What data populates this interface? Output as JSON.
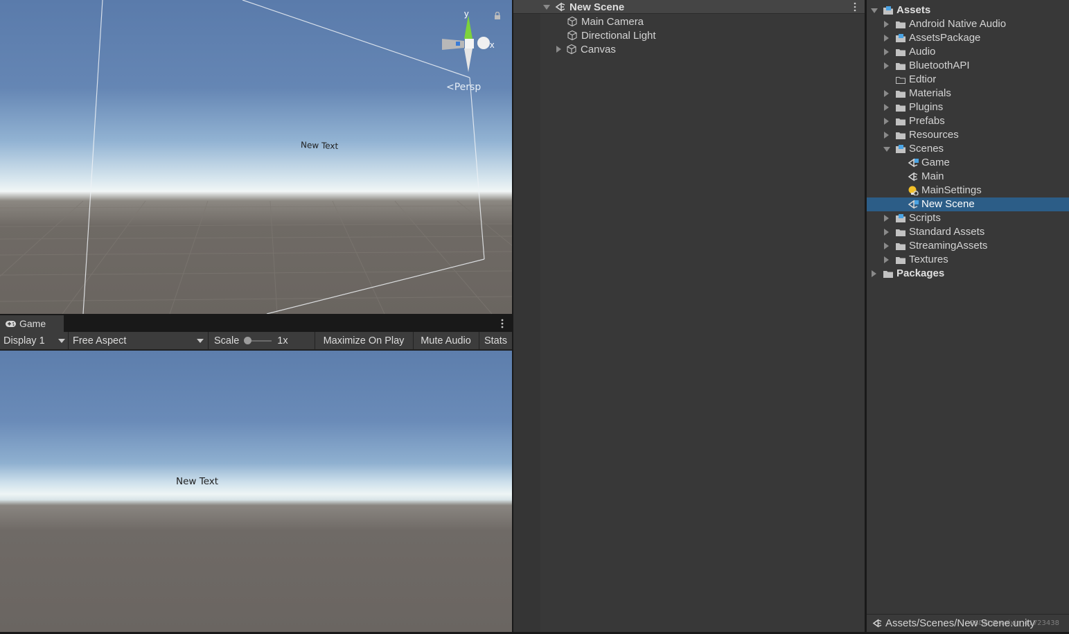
{
  "scene_view": {
    "canvas_text": "New Text",
    "gizmo": {
      "y_axis": "y",
      "x_axis": "x",
      "projection": "Persp"
    }
  },
  "game_view": {
    "tab_label": "Game",
    "display": "Display 1",
    "aspect": "Free Aspect",
    "scale_label": "Scale",
    "scale_value": "1x",
    "maximize_on_play": "Maximize On Play",
    "mute_audio": "Mute Audio",
    "stats": "Stats",
    "canvas_text": "New Text"
  },
  "hierarchy": {
    "scene_name": "New Scene",
    "objects": [
      {
        "label": "Main Camera",
        "expandable": false
      },
      {
        "label": "Directional Light",
        "expandable": false
      },
      {
        "label": "Canvas",
        "expandable": true
      }
    ]
  },
  "project": {
    "assets_root": "Assets",
    "folders_top": [
      "Android Native Audio",
      "AssetsPackage",
      "Audio",
      "BluetoothAPI",
      "Edtior",
      "Materials",
      "Plugins",
      "Prefabs",
      "Resources"
    ],
    "scenes_folder": "Scenes",
    "scenes": [
      "Game",
      "Main",
      "MainSettings",
      "New Scene"
    ],
    "selected_scene": "New Scene",
    "folders_bottom": [
      "Scripts",
      "Standard Assets",
      "StreamingAssets",
      "Textures"
    ],
    "packages_root": "Packages",
    "footer_path": "Assets/Scenes/New Scene.unity",
    "watermark": "CSDN @weixin_41723438"
  },
  "colors": {
    "selection": "#2c5d87",
    "panel_bg": "#383838",
    "toolbar_bg": "#3c3c3c",
    "gizmo_y": "#7dd33b",
    "gizmo_x": "#e8e8e8",
    "scene_icon_blue": "#4aa3e3",
    "settings_icon_yellow": "#f2c029"
  },
  "icons": {
    "game_tab": "gamepad-icon",
    "scene": "unity-scene-icon",
    "gameobject": "cube-icon",
    "folder": "folder-icon",
    "folder_empty": "folder-outline-icon",
    "package_folder": "package-folder-icon",
    "scene_settings": "lightbulb-gear-icon",
    "menu": "kebab-menu-icon",
    "lock": "lock-icon"
  }
}
